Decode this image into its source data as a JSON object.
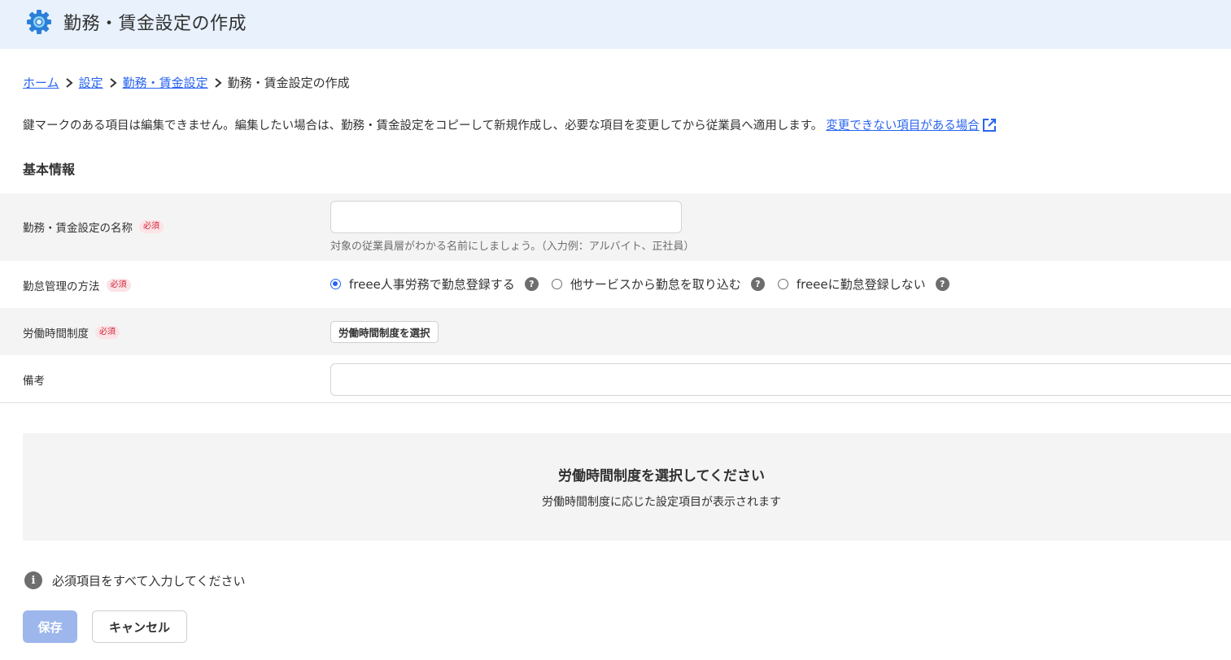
{
  "header": {
    "title": "勤務・賃金設定の作成",
    "icon": "gear-icon",
    "background": "#e8f1fc"
  },
  "breadcrumb": {
    "items": [
      {
        "label": "ホーム",
        "link": true
      },
      {
        "label": "設定",
        "link": true
      },
      {
        "label": "勤務・賃金設定",
        "link": true
      },
      {
        "label": "勤務・賃金設定の作成",
        "link": false
      }
    ]
  },
  "notice": {
    "text": "鍵マークのある項目は編集できません。編集したい場合は、勤務・賃金設定をコピーして新規作成し、必要な項目を変更してから従業員へ適用します。",
    "link_label": "変更できない項目がある場合",
    "link_icon": "external-link-icon"
  },
  "section": {
    "title": "基本情報"
  },
  "form": {
    "required_badge": "必須",
    "name_field": {
      "label": "勤務・賃金設定の名称",
      "value": "",
      "hint": "対象の従業員層がわかる名前にしましょう。（入力例：アルバイト、正社員）"
    },
    "attendance_method": {
      "label": "勤怠管理の方法",
      "options": [
        {
          "label": "freee人事労務で勤怠登録する",
          "selected": true
        },
        {
          "label": "他サービスから勤怠を取り込む",
          "selected": false
        },
        {
          "label": "freeeに勤怠登録しない",
          "selected": false
        }
      ],
      "help_glyph": "?"
    },
    "working_time_system": {
      "label": "労働時間制度",
      "button_label": "労働時間制度を選択"
    },
    "remarks": {
      "label": "備考",
      "value": ""
    }
  },
  "panel": {
    "title": "労働時間制度を選択してください",
    "subtitle": "労働時間制度に応じた設定項目が表示されます"
  },
  "footer": {
    "info_text": "必須項目をすべて入力してください",
    "info_glyph": "i",
    "save_label": "保存",
    "cancel_label": "キャンセル"
  },
  "colors": {
    "link": "#2864f0",
    "required_badge_bg": "#fbe3e6",
    "required_badge_text": "#d0243b",
    "save_disabled": "#9db6ec",
    "row_shade": "#f5f4f4"
  }
}
